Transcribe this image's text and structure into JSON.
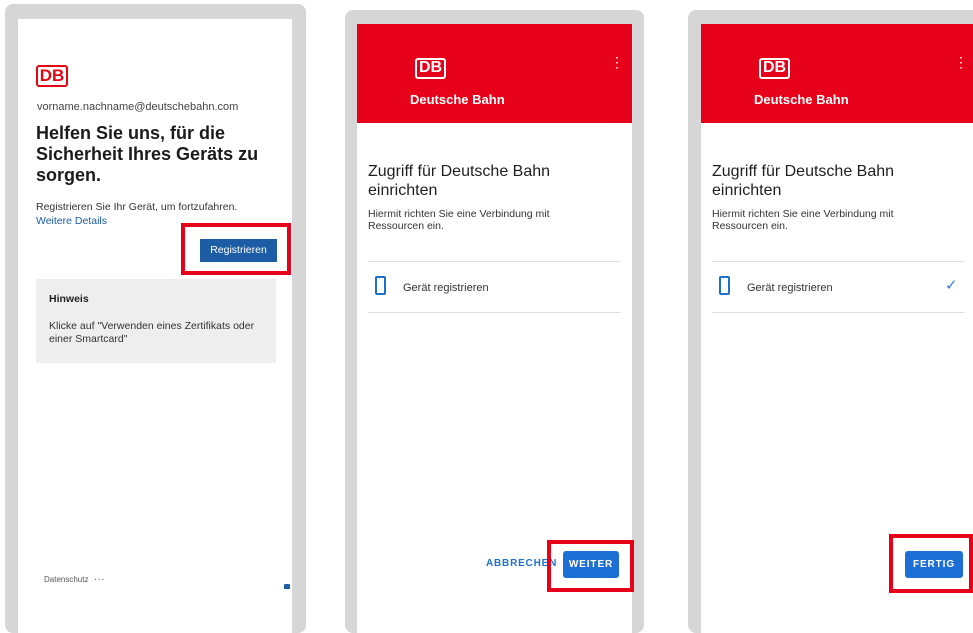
{
  "colors": {
    "db_red": "#e6001a",
    "primary_blue": "#1c5da5",
    "highlight": "#e6001a"
  },
  "screen1": {
    "logo": "DB",
    "email": "vorname.nachname@deutschebahn.com",
    "title": "Helfen Sie uns, für die Sicherheit Ihres Geräts zu sorgen.",
    "description": "Registrieren Sie Ihr Gerät, um fortzufahren.",
    "details_link": "Weitere Details",
    "register_button": "Registrieren",
    "notice_title": "Hinweis",
    "notice_text": "Klicke auf \"Verwenden eines Zertifikats oder einer Smartcard\"",
    "privacy_link": "Datenschutz",
    "more_dots": "..."
  },
  "screen2": {
    "logo": "DB",
    "app_title": "Deutsche Bahn",
    "menu": "⋮",
    "heading": "Zugriff für Deutsche Bahn einrichten",
    "description": "Hiermit richten Sie eine Verbindung mit Ressourcen ein.",
    "step_label": "Gerät registrieren",
    "cancel_button": "ABBRECHEN",
    "next_button": "WEITER"
  },
  "screen3": {
    "logo": "DB",
    "app_title": "Deutsche Bahn",
    "menu": "⋮",
    "heading": "Zugriff für Deutsche Bahn einrichten",
    "description": "Hiermit richten Sie eine Verbindung mit Ressourcen ein.",
    "step_label": "Gerät registrieren",
    "check": "✓",
    "done_button": "FERTIG"
  }
}
